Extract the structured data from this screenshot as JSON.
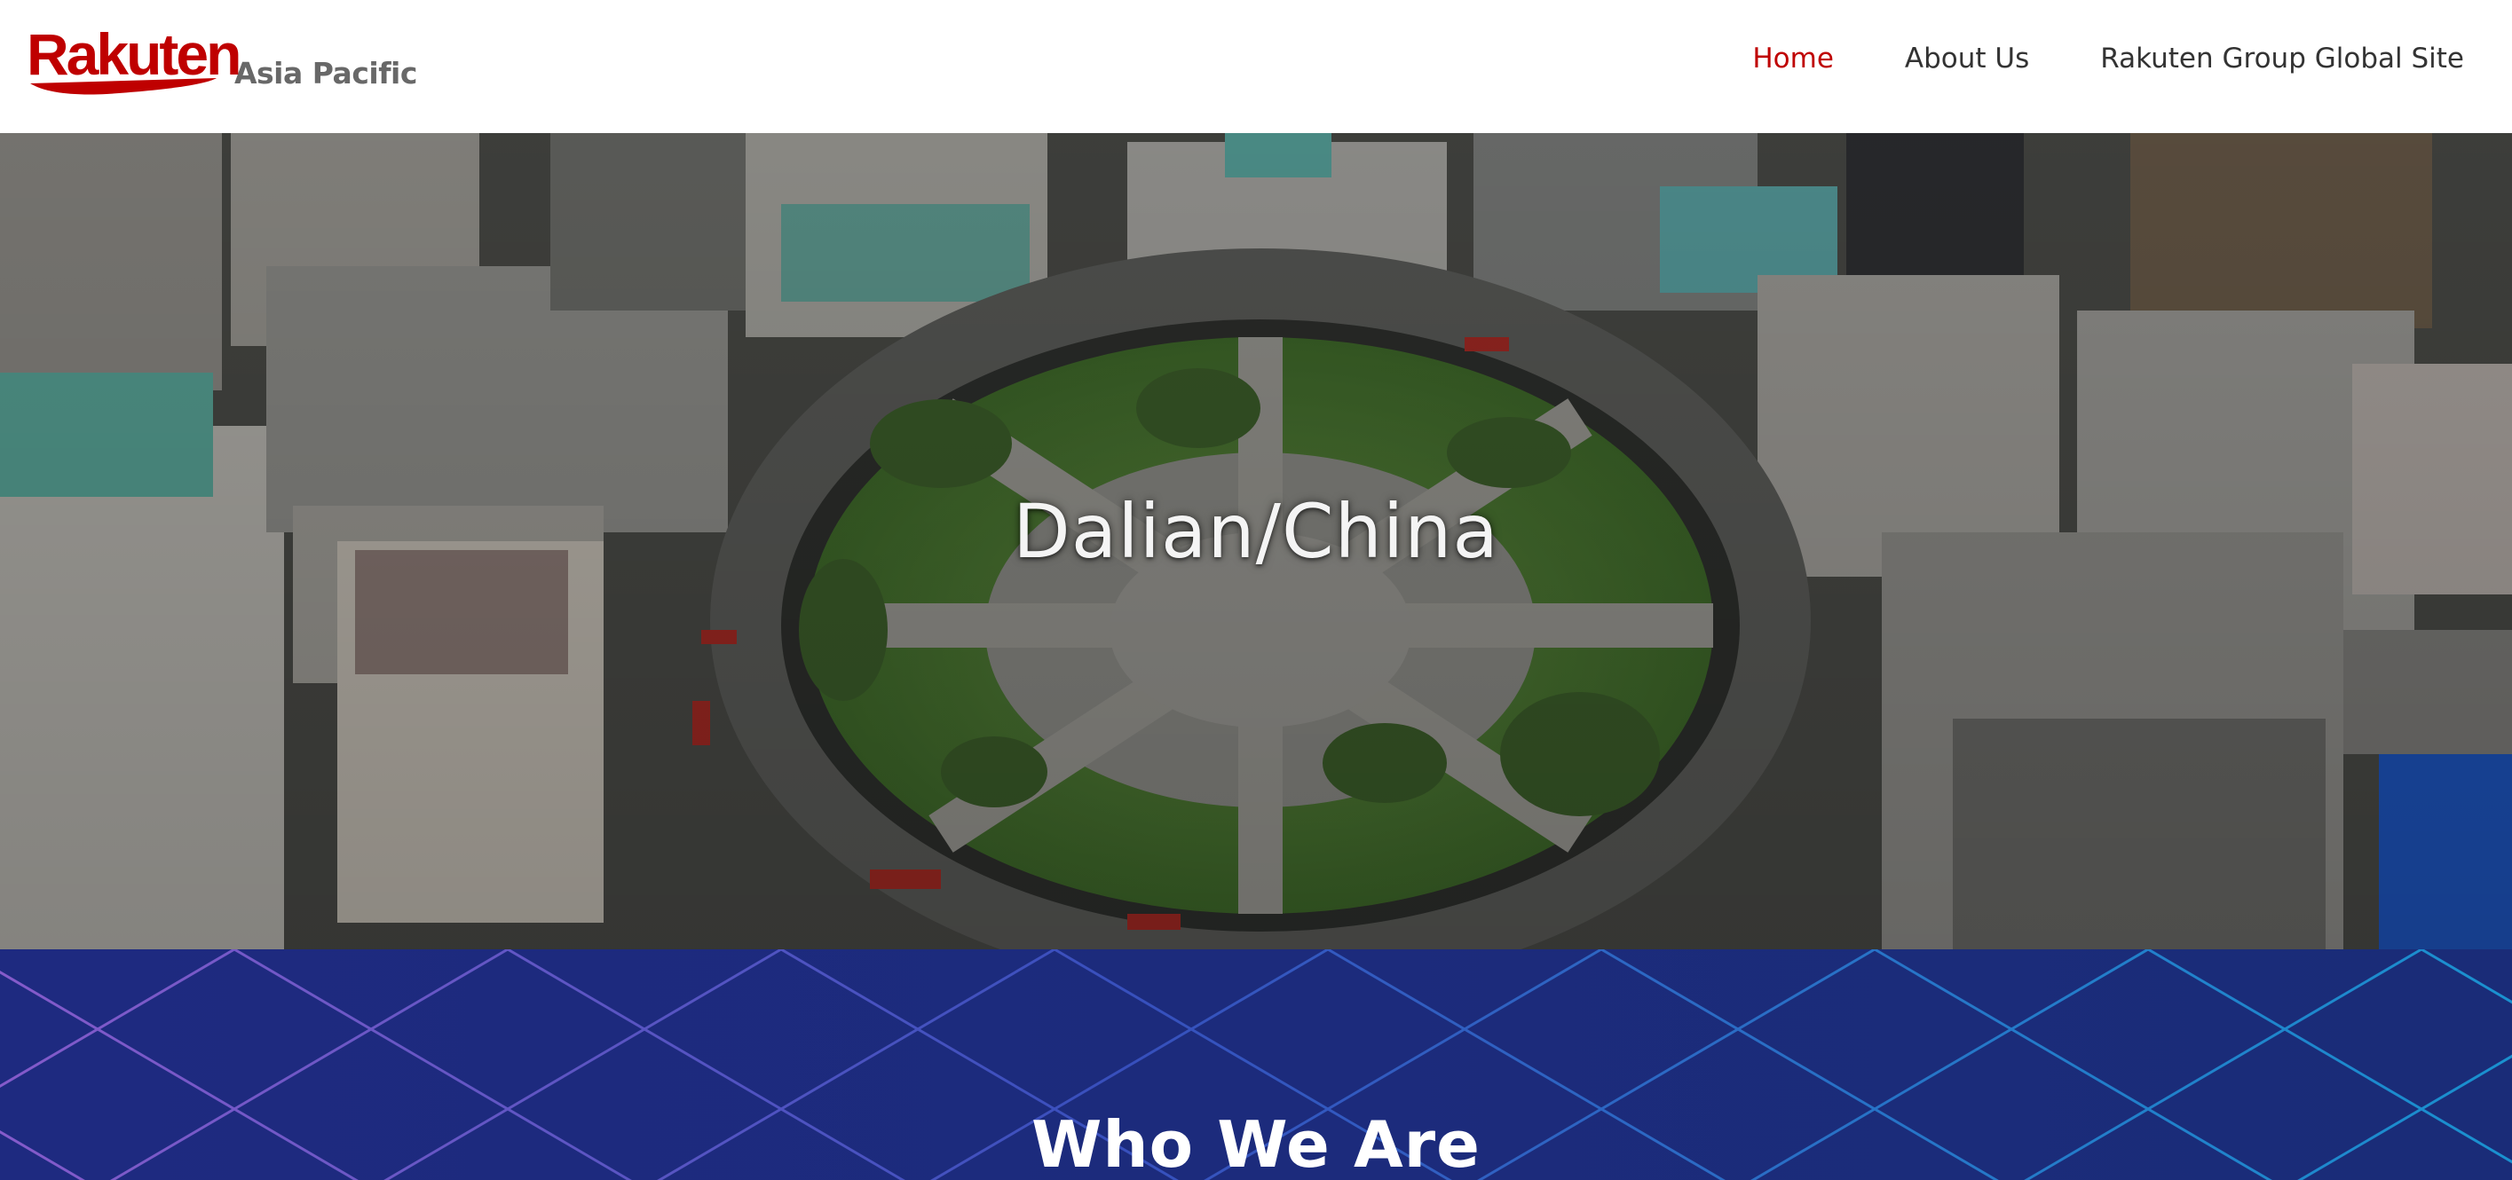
{
  "header": {
    "logo_text": "Rakuten",
    "logo_suffix": "Asia Pacific",
    "nav": [
      {
        "label": "Home",
        "active": true
      },
      {
        "label": "About Us",
        "active": false
      },
      {
        "label": "Rakuten Group Global Site",
        "active": false
      }
    ]
  },
  "hero": {
    "title": "Dalian/China"
  },
  "who": {
    "title": "Who We Are"
  },
  "colors": {
    "brand_red": "#bf0000",
    "nav_text": "#333333",
    "who_bg": "#1b2a7a"
  }
}
